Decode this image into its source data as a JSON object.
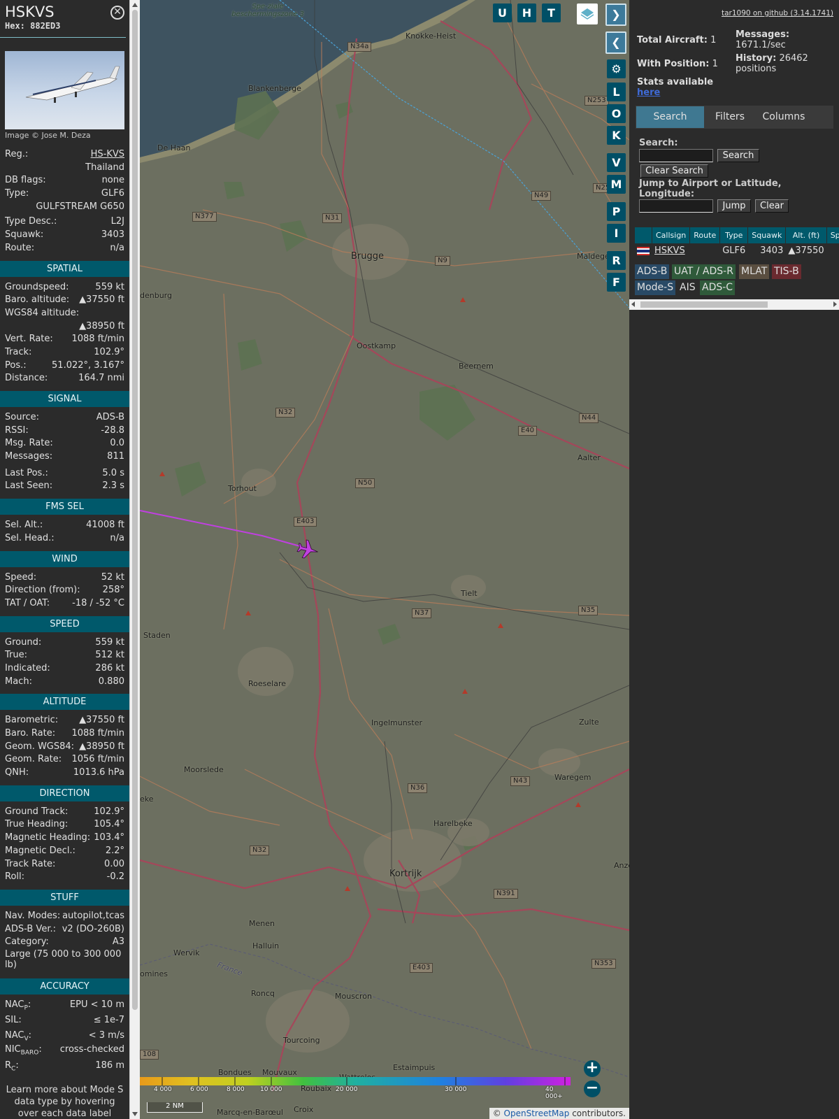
{
  "selected": {
    "callsign": "HSKVS",
    "hex": "Hex: 882ED3",
    "photo_credit": "Image © Jose M. Deza",
    "top": [
      {
        "k": "Reg.:",
        "v": "HS-KVS"
      },
      {
        "k": "",
        "v": "Thailand"
      },
      {
        "k": "DB flags:",
        "v": "none"
      },
      {
        "k": "Type:",
        "v": "GLF6"
      },
      {
        "k": "",
        "v": "GULFSTREAM G650"
      },
      {
        "k": "Type Desc.:",
        "v": "L2J"
      },
      {
        "k": "Squawk:",
        "v": "3403"
      },
      {
        "k": "Route:",
        "v": "n/a"
      }
    ],
    "spatial": {
      "title": "SPATIAL",
      "groundspeed_k": "Groundspeed:",
      "groundspeed_v": "559 kt",
      "baro_k": "Baro. altitude:",
      "baro_v": "▲37550 ft",
      "wgs_k": "WGS84 altitude:",
      "wgs_v": "▲38950 ft",
      "vrate_k": "Vert. Rate:",
      "vrate_v": "1088 ft/min",
      "track_k": "Track:",
      "track_v": "102.9°",
      "pos_k": "Pos.:",
      "pos_v": "51.022°, 3.167°",
      "dist_k": "Distance:",
      "dist_v": "164.7 nmi"
    },
    "signal": {
      "title": "SIGNAL",
      "source_k": "Source:",
      "source_v": "ADS-B",
      "rssi_k": "RSSI:",
      "rssi_v": "-28.8",
      "msgrate_k": "Msg. Rate:",
      "msgrate_v": "0.0",
      "msgs_k": "Messages:",
      "msgs_v": "811",
      "lastpos_k": "Last Pos.:",
      "lastpos_v": "5.0 s",
      "lastseen_k": "Last Seen:",
      "lastseen_v": "2.3 s"
    },
    "fms": {
      "title": "FMS SEL",
      "alt_k": "Sel. Alt.:",
      "alt_v": "41008 ft",
      "head_k": "Sel. Head.:",
      "head_v": "n/a"
    },
    "wind": {
      "title": "WIND",
      "speed_k": "Speed:",
      "speed_v": "52 kt",
      "dir_k": "Direction (from):",
      "dir_v": "258°",
      "tat_k": "TAT / OAT:",
      "tat_v": "-18 / -52 °C"
    },
    "speed": {
      "title": "SPEED",
      "ground_k": "Ground:",
      "ground_v": "559 kt",
      "true_k": "True:",
      "true_v": "512 kt",
      "ind_k": "Indicated:",
      "ind_v": "286 kt",
      "mach_k": "Mach:",
      "mach_v": "0.880"
    },
    "altitude": {
      "title": "ALTITUDE",
      "baro_k": "Barometric:",
      "baro_v": "▲37550 ft",
      "brate_k": "Baro. Rate:",
      "brate_v": "1088 ft/min",
      "geom_k": "Geom. WGS84:",
      "geom_v": "▲38950 ft",
      "grate_k": "Geom. Rate:",
      "grate_v": "1056 ft/min",
      "qnh_k": "QNH:",
      "qnh_v": "1013.6 hPa"
    },
    "direction": {
      "title": "DIRECTION",
      "gt_k": "Ground Track:",
      "gt_v": "102.9°",
      "th_k": "True Heading:",
      "th_v": "105.4°",
      "mh_k": "Magnetic Heading:",
      "mh_v": "103.4°",
      "md_k": "Magnetic Decl.:",
      "md_v": "2.2°",
      "tr_k": "Track Rate:",
      "tr_v": "0.00",
      "roll_k": "Roll:",
      "roll_v": "-0.2"
    },
    "stuff": {
      "title": "STUFF",
      "nav_k": "Nav. Modes:",
      "nav_v": "autopilot,tcas",
      "adsb_k": "ADS-B Ver.:",
      "adsb_v": "v2 (DO-260B)",
      "cat_k": "Category:",
      "cat_v": "A3",
      "cat_desc": "Large (75 000 to 300 000 lb)"
    },
    "accuracy": {
      "title": "ACCURACY",
      "nacp_k": "NAC",
      "nacp_sub": "P",
      "nacp_v": "EPU < 10 m",
      "sil_k": "SIL:",
      "sil_v": "≤ 1e-7",
      "nacv_k": "NAC",
      "nacv_sub": "V",
      "nacv_v": "< 3 m/s",
      "nic_k": "NIC",
      "nic_sub": "BARO",
      "nic_v": "cross-checked",
      "rc_k": "R",
      "rc_sub": "C",
      "rc_v": "186 m"
    },
    "learn_more": "Learn more about Mode S data type by hovering over each data label"
  },
  "map": {
    "labels": [
      "Knokke-Heist",
      "Blankenberge",
      "De Haan",
      "Brugge",
      "Oostkamp",
      "Beernem",
      "Aalter",
      "Torhout",
      "Tielt",
      "Staden",
      "Roeselare",
      "Ingelmunster",
      "Zulte",
      "Moorslede",
      "Waregem",
      "Harelbeke",
      "Kortrijk",
      "Menen",
      "Halluin",
      "Wervik",
      "Roncq",
      "Mouscron",
      "Tourcoing",
      "Bondues",
      "Mouvaux",
      "Wattrelos",
      "Estaimpuis",
      "Roubaix",
      "Croix",
      "Marcq-en-Barœul",
      "Maldegem",
      "denburg",
      "eke",
      "omines",
      "Anze",
      "France",
      "Spe-ziale beschermingszone 3"
    ],
    "roads": [
      "N34a",
      "N253",
      "N49",
      "N25",
      "N377",
      "N31",
      "N9",
      "E40",
      "N44",
      "N32",
      "N50",
      "E403",
      "N37",
      "N35",
      "N36",
      "N43",
      "N32",
      "N391",
      "E403",
      "N353",
      "108"
    ],
    "buttons": {
      "u": "U",
      "h": "H",
      "t": "T",
      "l": "L",
      "o": "O",
      "k": "K",
      "v": "V",
      "m": "M",
      "p": "P",
      "i": "I",
      "r": "R",
      "f": "F"
    },
    "altitude_scale": [
      "4 000",
      "6 000",
      "8 000",
      "10 000",
      "20 000",
      "30 000",
      "40 000+"
    ],
    "scale": "2 NM",
    "attribution_prefix": "© ",
    "attribution_osm": "OpenStreetMap",
    "attribution_suffix": " contributors."
  },
  "sidebar": {
    "github": "tar1090 on github (3.14.1741)",
    "total_label": "Total Aircraft:",
    "total_value": "1",
    "withpos_label": "With Position:",
    "withpos_value": "1",
    "stats_label": "Stats available",
    "stats_link": "here",
    "messages_label": "Messages:",
    "messages_value": "1671.1/sec",
    "history_label": "History:",
    "history_value": "26462 positions",
    "tabs": [
      "Search",
      "Filters",
      "Columns"
    ],
    "search_label": "Search:",
    "search_button": "Search",
    "clear_search_button": "Clear Search",
    "jump_label": "Jump to Airport or Latitude, Longitude:",
    "jump_button": "Jump",
    "clear_button": "Clear",
    "table": {
      "columns": [
        "Callsign",
        "Route",
        "Type",
        "Squawk",
        "Alt. (ft)",
        "Spd"
      ],
      "row": {
        "callsign": "HSKVS",
        "route": "",
        "type": "GLF6",
        "squawk": "3403",
        "alt": "▲37550"
      }
    },
    "legend": [
      "ADS-B",
      "UAT / ADS-R",
      "MLAT",
      "TIS-B",
      "Mode-S",
      "AIS",
      "ADS-C"
    ]
  },
  "colors": {
    "accent": "#00596b",
    "track": "#c040e0",
    "aircraft": "#c040e0"
  }
}
